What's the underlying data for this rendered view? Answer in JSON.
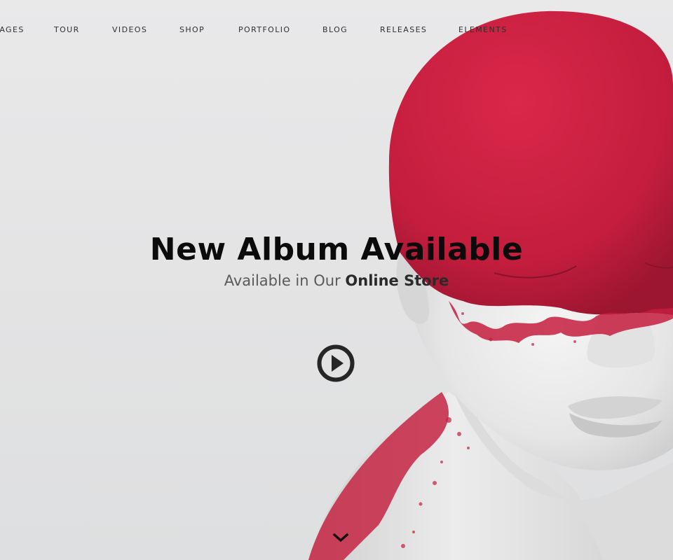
{
  "nav": {
    "items": [
      {
        "label": "PAGES"
      },
      {
        "label": "TOUR"
      },
      {
        "label": "VIDEOS"
      },
      {
        "label": "SHOP"
      },
      {
        "label": "PORTFOLIO"
      },
      {
        "label": "BLOG"
      },
      {
        "label": "RELEASES"
      },
      {
        "label": "ELEMENTS"
      }
    ]
  },
  "hero": {
    "title": "New Album Available",
    "subtitle_prefix": "Available in Our",
    "subtitle_link": "Online Store",
    "play_icon": "play-circle-icon",
    "scroll_icon": "chevron-down-icon"
  },
  "colors": {
    "accent_red": "#c8203f",
    "background": "#e4e4e5",
    "text_dark": "#0b0b0b"
  }
}
